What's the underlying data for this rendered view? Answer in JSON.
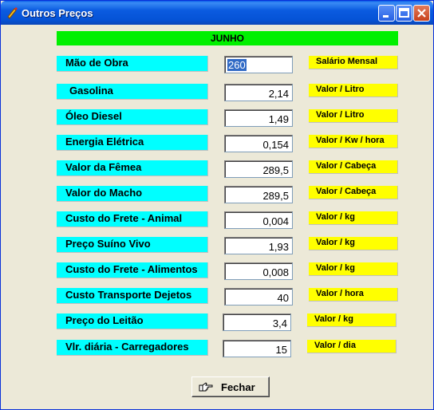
{
  "window": {
    "title": "Outros Preços"
  },
  "month": "JUNHO",
  "rows": [
    {
      "label": "Mão de Obra",
      "value": "260",
      "unit": "Salário Mensal"
    },
    {
      "label": "Gasolina",
      "value": "2,14",
      "unit": "Valor / Litro"
    },
    {
      "label": "Óleo Diesel",
      "value": "1,49",
      "unit": "Valor / Litro"
    },
    {
      "label": "Energia Elétrica",
      "value": "0,154",
      "unit": "Valor / Kw / hora"
    },
    {
      "label": "Valor da Fêmea",
      "value": "289,5",
      "unit": "Valor / Cabeça"
    },
    {
      "label": "Valor do Macho",
      "value": "289,5",
      "unit": "Valor / Cabeça"
    },
    {
      "label": "Custo do Frete  - Animal",
      "value": "0,004",
      "unit": "Valor / kg"
    },
    {
      "label": "Preço Suíno Vivo",
      "value": "1,93",
      "unit": "Valor / kg"
    },
    {
      "label": "Custo do Frete  - Alimentos",
      "value": "0,008",
      "unit": "Valor / kg"
    },
    {
      "label": "Custo Transporte Dejetos",
      "value": "40",
      "unit": "Valor / hora"
    },
    {
      "label": "Preço do Leitão",
      "value": "3,4",
      "unit": "Valor / kg"
    },
    {
      "label": "Vlr. diária - Carregadores",
      "value": "15",
      "unit": "Valor / dia"
    }
  ],
  "buttons": {
    "close_label": "Fechar"
  },
  "colors": {
    "label_bg": "#00ffff",
    "unit_bg": "#ffff00",
    "month_bg": "#00f000",
    "titlebar": "#0553d6"
  }
}
